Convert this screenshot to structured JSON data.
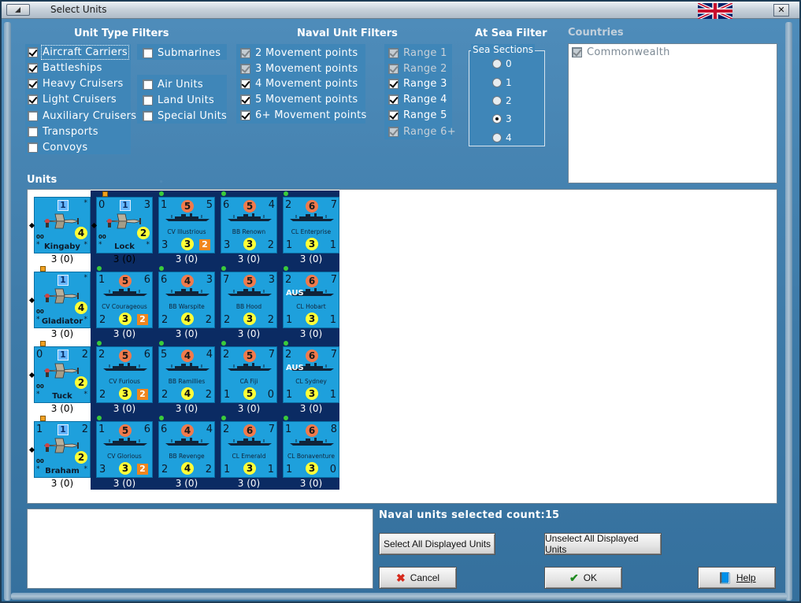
{
  "window": {
    "title": "Select Units"
  },
  "headers": {
    "unit_type_filters": "Unit Type Filters",
    "naval_unit_filters": "Naval Unit Filters",
    "at_sea_filter": "At Sea Filter",
    "countries": "Countries",
    "units": "Units"
  },
  "unit_types": [
    {
      "label": "Aircraft Carriers",
      "checked": true
    },
    {
      "label": "Battleships",
      "checked": true
    },
    {
      "label": "Heavy Cruisers",
      "checked": true
    },
    {
      "label": "Light Cruisers",
      "checked": true
    },
    {
      "label": "Auxiliary Cruisers",
      "checked": false
    },
    {
      "label": "Transports",
      "checked": false
    },
    {
      "label": "Convoys",
      "checked": false
    },
    {
      "label": "Submarines",
      "checked": false
    },
    {
      "label": "Air Units",
      "checked": false
    },
    {
      "label": "Land Units",
      "checked": false
    },
    {
      "label": "Special Units",
      "checked": false
    }
  ],
  "movement_filters": [
    {
      "label": "2 Movement points",
      "checked": true,
      "disabled": true
    },
    {
      "label": "3 Movement points",
      "checked": true,
      "disabled": true
    },
    {
      "label": "4 Movement points",
      "checked": true,
      "disabled": false
    },
    {
      "label": "5 Movement points",
      "checked": true,
      "disabled": false
    },
    {
      "label": "6+ Movement points",
      "checked": true,
      "disabled": false
    }
  ],
  "range_filters": [
    {
      "label": "Range 1",
      "checked": true,
      "disabled": true
    },
    {
      "label": "Range 2",
      "checked": true,
      "disabled": true
    },
    {
      "label": "Range 3",
      "checked": true,
      "disabled": false
    },
    {
      "label": "Range 4",
      "checked": true,
      "disabled": false
    },
    {
      "label": "Range 5",
      "checked": true,
      "disabled": false
    },
    {
      "label": "Range 6+",
      "checked": true,
      "disabled": true
    }
  ],
  "sea_sections": {
    "legend": "Sea Sections",
    "options": [
      "0",
      "1",
      "2",
      "3",
      "4"
    ],
    "selected": "3"
  },
  "countries": [
    {
      "label": "Commonwealth",
      "checked": true
    }
  ],
  "air_units": [
    {
      "name": "Kingaby",
      "tl": "",
      "tr": "",
      "bl": "*",
      "br": "*",
      "top": "1",
      "circle": "4",
      "strength": "3 (0)"
    },
    {
      "name": "Lock",
      "tl": "0",
      "tr": "3",
      "bl": "*",
      "br": "*",
      "top": "1",
      "circle": "2",
      "strength": "3 (0)"
    },
    {
      "name": "Gladiator",
      "tl": "",
      "tr": "",
      "bl": "*",
      "br": "*",
      "top": "1",
      "circle": "4",
      "strength": "3 (0)"
    },
    {
      "name": "Tuck",
      "tl": "0",
      "tr": "2",
      "bl": "*",
      "br": "*",
      "top": "1",
      "circle": "2",
      "strength": "3 (0)"
    },
    {
      "name": "Braham",
      "tl": "1",
      "tr": "2",
      "bl": "*",
      "br": "*",
      "top": "1",
      "circle": "2",
      "strength": "3 (0)"
    }
  ],
  "naval_units": [
    {
      "name": "CV Illustrious",
      "tl": "1",
      "top": "5",
      "tr": "5",
      "bl": "3",
      "bottom": "3",
      "br": "2",
      "orange": true,
      "strength": "3 (0)"
    },
    {
      "name": "BB Renown",
      "tl": "6",
      "top": "5",
      "tr": "4",
      "bl": "3",
      "bottom": "3",
      "br": "2",
      "orange": false,
      "strength": "3 (0)"
    },
    {
      "name": "CL Enterprise",
      "tl": "2",
      "top": "6",
      "tr": "7",
      "bl": "1",
      "bottom": "3",
      "br": "1",
      "orange": false,
      "strength": "3 (0)"
    },
    {
      "name": "CV Courageous",
      "tl": "1",
      "top": "5",
      "tr": "6",
      "bl": "2",
      "bottom": "3",
      "br": "2",
      "orange": true,
      "strength": "3 (0)"
    },
    {
      "name": "BB Warspite",
      "tl": "6",
      "top": "4",
      "tr": "3",
      "bl": "2",
      "bottom": "4",
      "br": "2",
      "orange": false,
      "strength": "3 (0)"
    },
    {
      "name": "BB Hood",
      "tl": "7",
      "top": "5",
      "tr": "3",
      "bl": "2",
      "bottom": "3",
      "br": "2",
      "orange": false,
      "strength": "3 (0)"
    },
    {
      "name": "CL Hobart",
      "tl": "2",
      "top": "6",
      "tr": "7",
      "bl": "1",
      "bottom": "3",
      "br": "1",
      "orange": false,
      "aus": "AUS",
      "strength": "3 (0)"
    },
    {
      "name": "CV Furious",
      "tl": "2",
      "top": "5",
      "tr": "6",
      "bl": "2",
      "bottom": "3",
      "br": "2",
      "orange": true,
      "strength": "3 (0)"
    },
    {
      "name": "BB Ramillies",
      "tl": "5",
      "top": "4",
      "tr": "4",
      "bl": "2",
      "bottom": "4",
      "br": "2",
      "orange": false,
      "strength": "3 (0)"
    },
    {
      "name": "CA Fiji",
      "tl": "2",
      "top": "5",
      "tr": "7",
      "bl": "1",
      "bottom": "5",
      "br": "0",
      "orange": false,
      "strength": "3 (0)"
    },
    {
      "name": "CL Sydney",
      "tl": "2",
      "top": "6",
      "tr": "7",
      "bl": "1",
      "bottom": "3",
      "br": "1",
      "orange": false,
      "aus": "AUS",
      "strength": "3 (0)"
    },
    {
      "name": "CV Glorious",
      "tl": "1",
      "top": "5",
      "tr": "6",
      "bl": "3",
      "bottom": "3",
      "br": "2",
      "orange": true,
      "strength": "3 (0)"
    },
    {
      "name": "BB Revenge",
      "tl": "6",
      "top": "4",
      "tr": "4",
      "bl": "2",
      "bottom": "4",
      "br": "2",
      "orange": false,
      "strength": "3 (0)"
    },
    {
      "name": "CL Emerald",
      "tl": "2",
      "top": "6",
      "tr": "7",
      "bl": "1",
      "bottom": "3",
      "br": "1",
      "orange": false,
      "strength": "3 (0)"
    },
    {
      "name": "CL Bonaventure",
      "tl": "1",
      "top": "6",
      "tr": "8",
      "bl": "1",
      "bottom": "3",
      "br": "0",
      "orange": false,
      "strength": "3 (0)"
    }
  ],
  "summary": {
    "count_label": "Naval units selected count:",
    "count_value": "15"
  },
  "buttons": {
    "select_all": "Select All Displayed Units",
    "unselect_all": "Unselect All Displayed Units",
    "cancel": "Cancel",
    "ok": "OK",
    "help": "Help"
  },
  "colors": {
    "panel": "#3f86b8",
    "counter": "#1ea0dc",
    "naval_bg": "#0b2b63"
  }
}
